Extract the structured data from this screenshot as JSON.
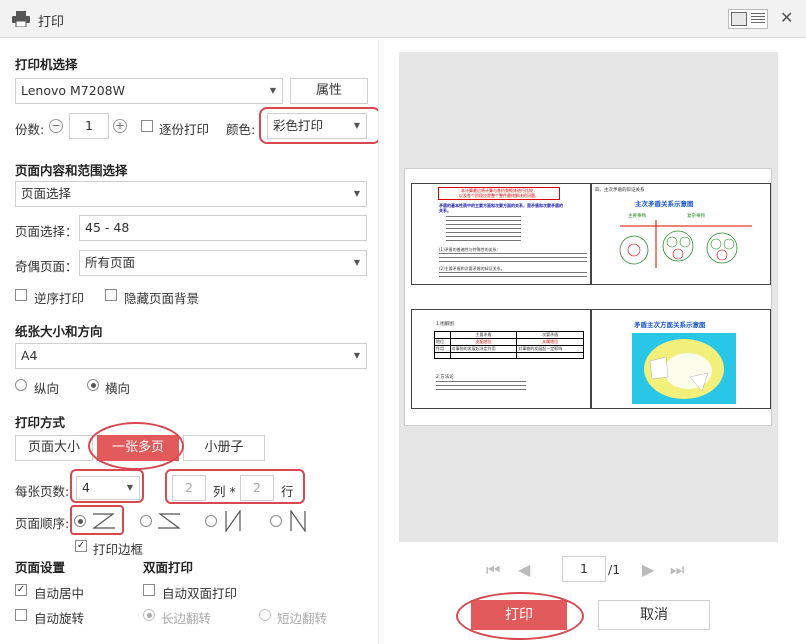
{
  "window": {
    "title": "打印"
  },
  "printer": {
    "section": "打印机选择",
    "name": "Lenovo M7208W",
    "properties": "属性",
    "copies_label": "份数:",
    "copies": "1",
    "collate": "逐份打印",
    "color_label": "颜色:",
    "color": "彩色打印"
  },
  "range": {
    "section": "页面内容和范围选择",
    "scope": "页面选择",
    "pages_label": "页面选择：",
    "pages": "45 - 48",
    "oddeven_label": "奇偶页面：",
    "oddeven": "所有页面",
    "reverse": "逆序打印",
    "hide_bg": "隐藏页面背景"
  },
  "paper": {
    "section": "纸张大小和方向",
    "size": "A4",
    "portrait": "纵向",
    "landscape": "横向"
  },
  "mode": {
    "section": "打印方式",
    "tabs": [
      "页面大小",
      "一张多页",
      "小册子"
    ],
    "per_sheet_label": "每张页数:",
    "per_sheet": "4",
    "cols": "2",
    "col_unit": "列 *",
    "rows": "2",
    "row_unit": "行",
    "order_label": "页面顺序:",
    "border": "打印边框"
  },
  "page_settings": {
    "section": "页面设置",
    "center": "自动居中",
    "rotate": "自动旋转"
  },
  "duplex": {
    "section": "双面打印",
    "auto": "自动双面打印",
    "long": "长边翻转",
    "short": "短边翻转"
  },
  "pager": {
    "current": "1",
    "total": "/1"
  },
  "actions": {
    "print": "打印",
    "cancel": "取消"
  },
  "preview": {
    "p1_red1": "本计算最后将计算与各约束矩阵进行比较，",
    "p1_red2": "以及各个阶段应是整个整件最终解决的问题。",
    "p1_blue": "矛盾的基本性质中的主要方面和次要方面的关系，是矛盾和次要矛盾的关系。",
    "p1_txt1": "(1)矛盾的普遍性与特殊性的关系：",
    "p1_txt2": "(2)主要矛盾和次要矛盾的辩证关系。",
    "p2_head": "四、主次矛盾的辩证关系",
    "p2_title": "主次矛盾关系示意图",
    "p2_a": "主要事物",
    "p2_b": "复杂事物",
    "p3_head": "1.图解图",
    "p3_h1": "主要矛盾",
    "p3_h2": "次要矛盾",
    "p3_r1": "地位",
    "p3_r1a": "支配地位",
    "p3_r1b": "从属地位",
    "p3_r2": "作用",
    "p3_r2a": "对事物的发展起决定作用",
    "p3_r2b": "对事物的发展起一定影响",
    "p3_note": "2.方法论",
    "p4_title": "矛盾主次方面关系示意图"
  }
}
